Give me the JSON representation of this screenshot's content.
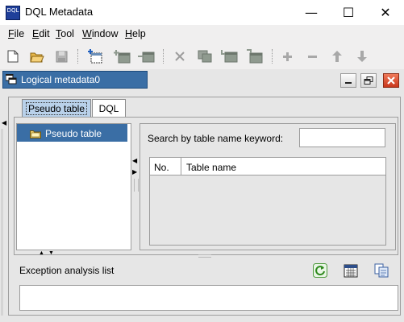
{
  "window": {
    "title": "DQL Metadata",
    "app_icon_text": "DQL",
    "controls": {
      "minimize": "—",
      "maximize": "☐",
      "close": "✕"
    }
  },
  "menu": {
    "items": [
      {
        "label": "File",
        "mnemonic": "F"
      },
      {
        "label": "Edit",
        "mnemonic": "E"
      },
      {
        "label": "Tool",
        "mnemonic": "T"
      },
      {
        "label": "Window",
        "mnemonic": "W"
      },
      {
        "label": "Help",
        "mnemonic": "H"
      }
    ]
  },
  "toolbar": {
    "buttons": [
      {
        "icon": "new-file-icon",
        "enabled": true
      },
      {
        "icon": "open-folder-icon",
        "enabled": true
      },
      {
        "icon": "save-icon",
        "enabled": false
      },
      {
        "icon": "new-table-icon",
        "enabled": true
      },
      {
        "icon": "add-table-icon",
        "enabled": false
      },
      {
        "icon": "add-field-icon",
        "enabled": false
      },
      {
        "icon": "delete-icon",
        "enabled": false
      },
      {
        "icon": "copy-table-icon",
        "enabled": false
      },
      {
        "icon": "import-table-icon",
        "enabled": false
      },
      {
        "icon": "export-table-icon",
        "enabled": false
      },
      {
        "icon": "plus-icon",
        "enabled": false
      },
      {
        "icon": "minus-icon",
        "enabled": false
      },
      {
        "icon": "arrow-up-icon",
        "enabled": false
      },
      {
        "icon": "arrow-down-icon",
        "enabled": false
      }
    ]
  },
  "inner_window": {
    "title": "Logical metadata0",
    "controls": [
      "minimize",
      "restore",
      "close"
    ]
  },
  "tabs": [
    {
      "label": "Pseudo table",
      "active": true
    },
    {
      "label": "DQL",
      "active": false
    }
  ],
  "tree": {
    "items": [
      {
        "label": "Pseudo table",
        "selected": true
      }
    ]
  },
  "search": {
    "label": "Search by table name keyword:",
    "value": ""
  },
  "table": {
    "columns": [
      "No.",
      "Table name"
    ],
    "rows": []
  },
  "exception": {
    "label": "Exception analysis list",
    "buttons": [
      "refresh-icon",
      "calendar-icon",
      "copy-icon"
    ]
  },
  "colors": {
    "selection_blue": "#3a6ea5",
    "active_tab": "#b9d1ea",
    "panel_gray": "#e6e6e6",
    "close_red": "#c8371c"
  }
}
